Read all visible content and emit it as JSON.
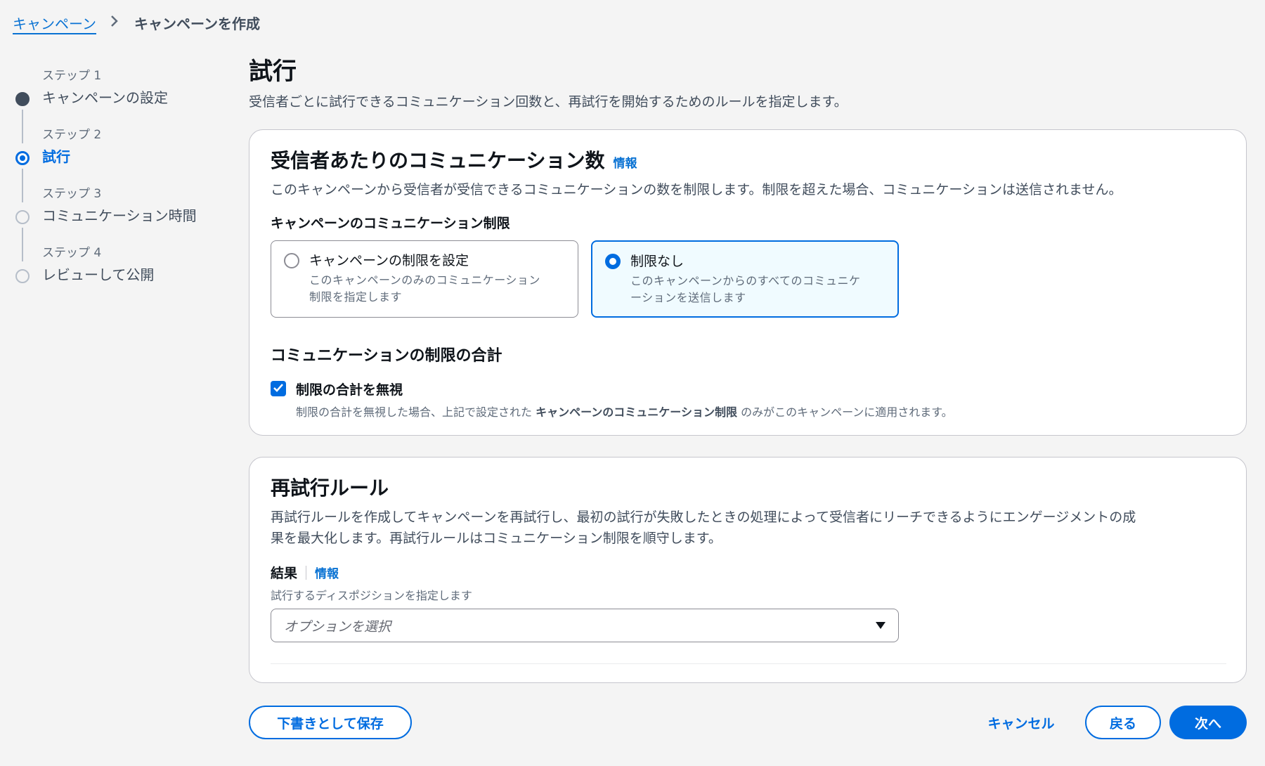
{
  "breadcrumb": {
    "parent": "キャンペーン",
    "current": "キャンペーンを作成"
  },
  "steps": [
    {
      "num": "ステップ 1",
      "title": "キャンペーンの設定"
    },
    {
      "num": "ステップ 2",
      "title": "試行"
    },
    {
      "num": "ステップ 3",
      "title": "コミュニケーション時間"
    },
    {
      "num": "ステップ 4",
      "title": "レビューして公開"
    }
  ],
  "page": {
    "title": "試行",
    "description": "受信者ごとに試行できるコミュニケーション回数と、再試行を開始するためのルールを指定します。"
  },
  "limits_panel": {
    "title": "受信者あたりのコミュニケーション数",
    "info": "情報",
    "description": "このキャンペーンから受信者が受信できるコミュニケーションの数を制限します。制限を超えた場合、コミュニケーションは送信されません。",
    "field_label": "キャンペーンのコミュニケーション制限",
    "options": [
      {
        "title": "キャンペーンの制限を設定",
        "desc_line1": "このキャンペーンのみのコミュニケーション",
        "desc_line2": "制限を指定します",
        "selected": false
      },
      {
        "title": "制限なし",
        "desc_line1": "このキャンペーンからのすべてのコミュニケ",
        "desc_line2": "ーションを送信します",
        "selected": true
      }
    ],
    "total_heading": "コミュニケーションの制限の合計",
    "checkbox_label": "制限の合計を無視",
    "checkbox_checked": true,
    "checkbox_desc_pre": "制限の合計を無視した場合、上記で設定された ",
    "checkbox_desc_bold": "キャンペーンのコミュニケーション制限",
    "checkbox_desc_post": " のみがこのキャンペーンに適用されます。"
  },
  "retry_panel": {
    "title": "再試行ルール",
    "description_line1": "再試行ルールを作成してキャンペーンを再試行し、最初の試行が失敗したときの処理によって受信者にリーチできるようにエンゲージメントの成",
    "description_line2": "果を最大化します。再試行ルールはコミュニケーション制限を順守します。",
    "result_label": "結果",
    "info": "情報",
    "result_desc": "試行するディスポジションを指定します",
    "select_placeholder": "オプションを選択"
  },
  "footer": {
    "save_draft": "下書きとして保存",
    "cancel": "キャンセル",
    "back": "戻る",
    "next": "次へ"
  },
  "colors": {
    "accent": "#006ce0",
    "background": "#f4f4f4",
    "text": "#0f141a"
  },
  "icons": {
    "breadcrumb_separator": "chevron-right-icon",
    "select_caret": "caret-down-icon",
    "checkbox": "check-icon"
  }
}
